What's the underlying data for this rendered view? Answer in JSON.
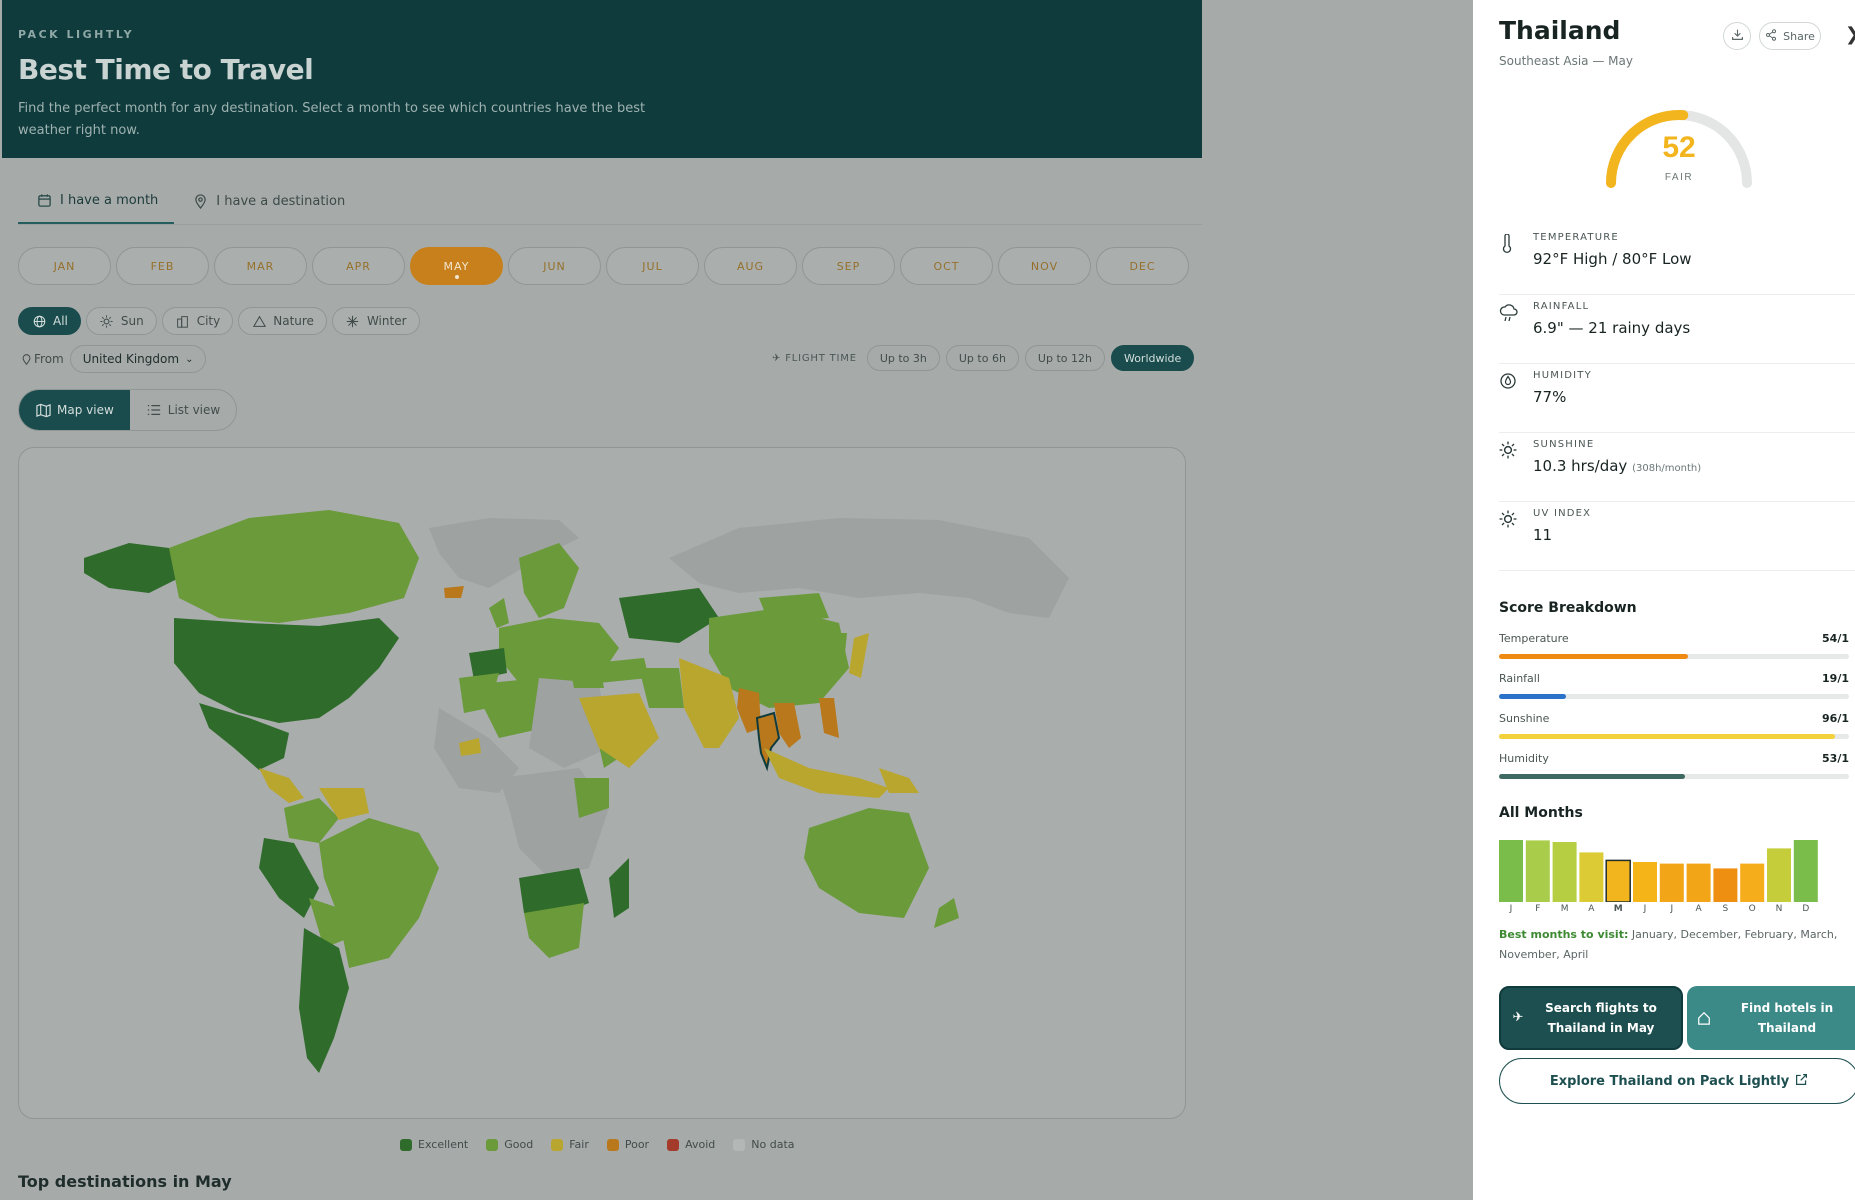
{
  "hero": {
    "eyebrow": "PACK LIGHTLY",
    "title": "Best Time to Travel",
    "description": "Find the perfect month for any destination. Select a month to see which countries have the best weather right now."
  },
  "tabs": [
    {
      "label": "I have a month",
      "icon": "calendar-icon",
      "active": true
    },
    {
      "label": "I have a destination",
      "icon": "pin-icon",
      "active": false
    }
  ],
  "months": [
    "JAN",
    "FEB",
    "MAR",
    "APR",
    "MAY",
    "JUN",
    "JUL",
    "AUG",
    "SEP",
    "OCT",
    "NOV",
    "DEC"
  ],
  "selected_month": "MAY",
  "filters": [
    {
      "label": "All",
      "icon": "globe-icon",
      "active": true
    },
    {
      "label": "Sun",
      "icon": "sun-icon",
      "active": false
    },
    {
      "label": "City",
      "icon": "city-icon",
      "active": false
    },
    {
      "label": "Nature",
      "icon": "mountain-icon",
      "active": false
    },
    {
      "label": "Winter",
      "icon": "snowflake-icon",
      "active": false
    }
  ],
  "from": {
    "label": "From",
    "value": "United Kingdom"
  },
  "flight_time": {
    "label": "FLIGHT TIME",
    "options": [
      "Up to 3h",
      "Up to 6h",
      "Up to 12h",
      "Worldwide"
    ],
    "selected": "Worldwide"
  },
  "view": {
    "map_label": "Map view",
    "list_label": "List view",
    "selected": "Map view"
  },
  "legend": [
    {
      "label": "Excellent",
      "color": "#2f6b2a"
    },
    {
      "label": "Good",
      "color": "#6a9a3a"
    },
    {
      "label": "Fair",
      "color": "#b9a62f"
    },
    {
      "label": "Poor",
      "color": "#b9781b"
    },
    {
      "label": "Avoid",
      "color": "#a33a2a"
    },
    {
      "label": "No data",
      "color": "#9ea2a1"
    }
  ],
  "top_destinations_title": "Top destinations in May",
  "detail": {
    "country": "Thailand",
    "subtitle": "Southeast Asia — May",
    "share_label": "Share",
    "score": 52,
    "score_max": 100,
    "score_label": "FAIR",
    "score_color": "#f2b51d",
    "metrics": [
      {
        "icon": "thermometer-icon",
        "label": "TEMPERATURE",
        "value": "92°F High / 80°F Low",
        "extra": ""
      },
      {
        "icon": "rain-cloud-icon",
        "label": "RAINFALL",
        "value": "6.9\" — 21 rainy days",
        "extra": ""
      },
      {
        "icon": "humidity-icon",
        "label": "HUMIDITY",
        "value": "77%",
        "extra": ""
      },
      {
        "icon": "sun-icon",
        "label": "SUNSHINE",
        "value": "10.3 hrs/day",
        "extra": "(308h/month)"
      },
      {
        "icon": "uv-icon",
        "label": "UV INDEX",
        "value": "11",
        "extra": ""
      }
    ],
    "breakdown_title": "Score Breakdown",
    "breakdown": [
      {
        "label": "Temperature",
        "value_text": "54/1",
        "fraction": 0.54,
        "color": "#ee8a12"
      },
      {
        "label": "Rainfall",
        "value_text": "19/1",
        "fraction": 0.19,
        "color": "#2b73c9"
      },
      {
        "label": "Sunshine",
        "value_text": "96/1",
        "fraction": 0.96,
        "color": "#f3d13a"
      },
      {
        "label": "Humidity",
        "value_text": "53/1",
        "fraction": 0.53,
        "color": "#3f6a62"
      }
    ],
    "all_months_title": "All Months",
    "all_months": [
      {
        "label": "J",
        "score": 82,
        "color": "#7bbd4a"
      },
      {
        "label": "F",
        "score": 77,
        "color": "#a9cc4a"
      },
      {
        "label": "M",
        "score": 75,
        "color": "#b5ce42"
      },
      {
        "label": "A",
        "score": 62,
        "color": "#dccb35"
      },
      {
        "label": "M",
        "score": 52,
        "color": "#f2b51d",
        "selected": true
      },
      {
        "label": "J",
        "score": 50,
        "color": "#f5b519"
      },
      {
        "label": "J",
        "score": 48,
        "color": "#f2a617"
      },
      {
        "label": "A",
        "score": 48,
        "color": "#f2a617"
      },
      {
        "label": "S",
        "score": 42,
        "color": "#ef8f12"
      },
      {
        "label": "O",
        "score": 48,
        "color": "#f5ad1b"
      },
      {
        "label": "N",
        "score": 67,
        "color": "#c5cd3b"
      },
      {
        "label": "D",
        "score": 82,
        "color": "#7bbd4a"
      }
    ],
    "best_label": "Best months to visit:",
    "best_text": "January, December, February, March, November, April",
    "cta_flights": "Search flights to Thailand in May",
    "cta_hotels": "Find hotels in Thailand",
    "explore": "Explore Thailand on Pack Lightly"
  }
}
